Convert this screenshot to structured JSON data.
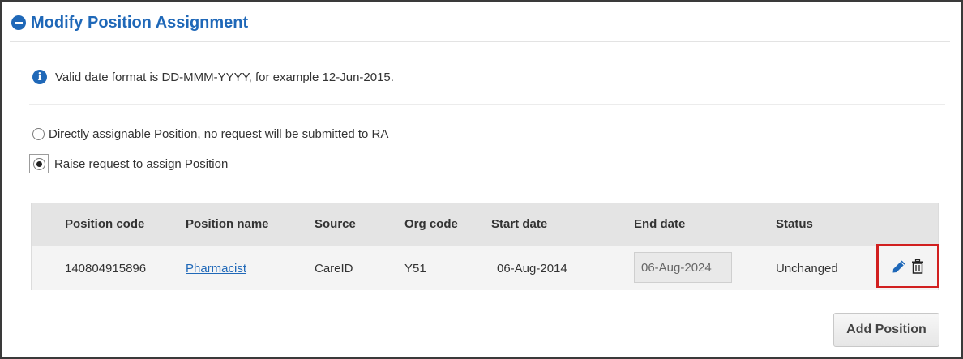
{
  "header": {
    "title": "Modify Position Assignment",
    "icon": "minus-circle-icon"
  },
  "info": {
    "text": "Valid date format is DD-MMM-YYYY, for example 12-Jun-2015.",
    "icon": "info-icon"
  },
  "options": [
    {
      "label": "Directly assignable Position, no request will be submitted to RA",
      "checked": false
    },
    {
      "label": "Raise request to assign Position",
      "checked": true
    }
  ],
  "table": {
    "headers": [
      "Position code",
      "Position name",
      "Source",
      "Org code",
      "Start date",
      "End date",
      "Status"
    ],
    "rows": [
      {
        "position_code": "140804915896",
        "position_name": "Pharmacist",
        "source": "CareID",
        "org_code": "Y51",
        "start_date": "06-Aug-2014",
        "end_date": "06-Aug-2024",
        "status": "Unchanged"
      }
    ],
    "actions": [
      "pencil-icon",
      "trash-icon"
    ]
  },
  "add_button": {
    "label": "Add Position"
  },
  "colors": {
    "accent": "#1f68b8",
    "highlight": "#d11f1f"
  }
}
